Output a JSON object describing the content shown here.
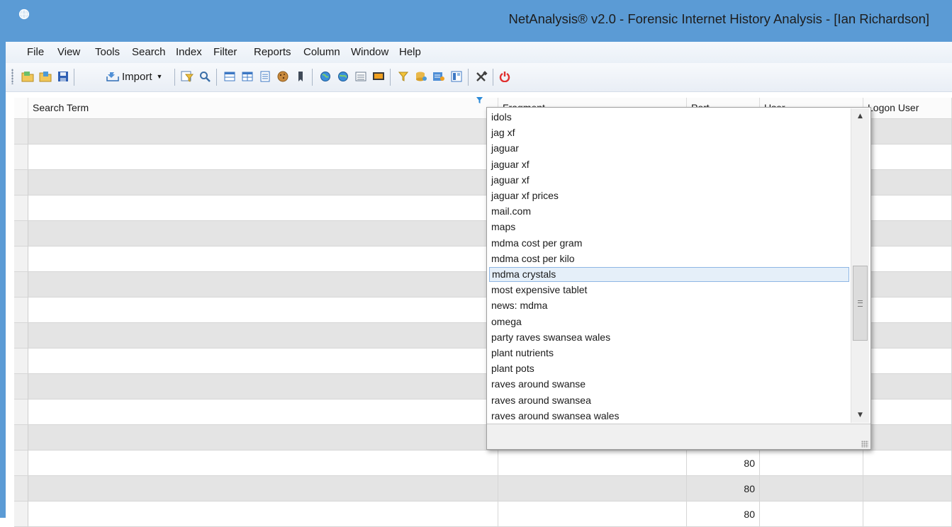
{
  "window": {
    "title": "NetAnalysis® v2.0 - Forensic Internet History Analysis - [Ian Richardson]",
    "accent_color": "#5b9bd5"
  },
  "menu": [
    "File",
    "View",
    "Tools",
    "Search",
    "Index",
    "Filter",
    "Reports",
    "Column",
    "Window",
    "Help"
  ],
  "toolbar": {
    "import_label": "Import",
    "icons": [
      "open-folder-icon",
      "open-file-icon",
      "save-icon",
      "import-icon",
      "filter-query-icon",
      "search-icon",
      "table-view-icon",
      "split-view-icon",
      "page-view-icon",
      "cookie-icon",
      "bookmark-icon",
      "globe-refresh-icon",
      "globe-icon",
      "list-icon",
      "monitor-icon",
      "filter-icon",
      "database-icon",
      "report-icon",
      "panel-icon",
      "tools-icon",
      "power-icon"
    ]
  },
  "grid": {
    "columns": [
      {
        "key": "search_term",
        "label": "Search Term"
      },
      {
        "key": "fragment",
        "label": "Fragment"
      },
      {
        "key": "port",
        "label": "Port"
      },
      {
        "key": "user",
        "label": "User"
      },
      {
        "key": "logon_user",
        "label": "Logon User"
      }
    ],
    "visible_port_values": [
      "80",
      "80",
      "80"
    ]
  },
  "filter_dropdown": {
    "items": [
      "idols",
      "jag xf",
      "jaguar",
      "jaguar xf",
      "jaguar xf",
      "jaguar xf prices",
      "mail.com",
      "maps",
      "mdma cost per gram",
      "mdma cost per kilo",
      "mdma crystals",
      "most expensive tablet",
      "news: mdma",
      "omega",
      "party raves swansea wales",
      "plant nutrients",
      "plant pots",
      "raves around swanse",
      "raves around swansea",
      "raves around swansea wales"
    ],
    "selected": "mdma crystals"
  }
}
